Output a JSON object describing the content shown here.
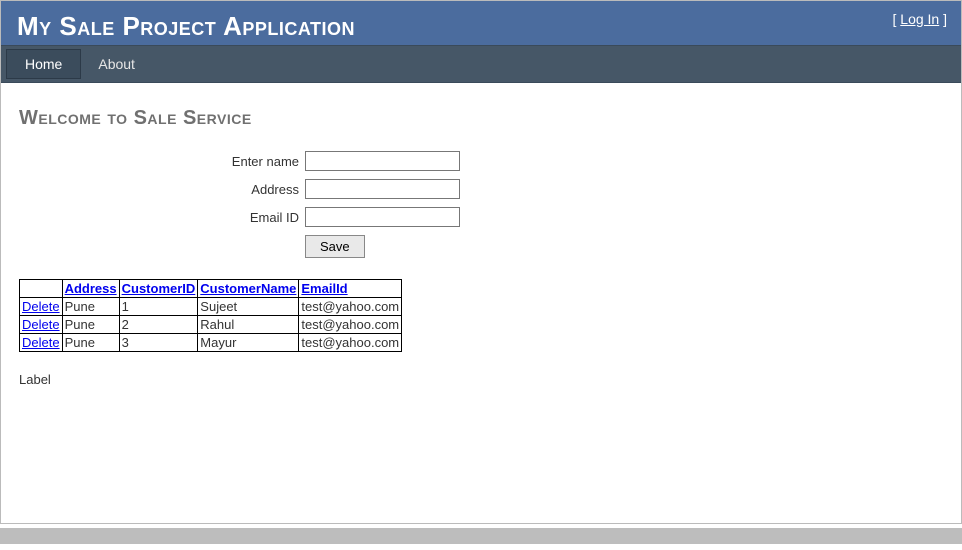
{
  "header": {
    "title": "My Sale Project Application",
    "loginLabel": "Log In"
  },
  "nav": {
    "items": [
      {
        "label": "Home",
        "active": true
      },
      {
        "label": "About",
        "active": false
      }
    ]
  },
  "page": {
    "title": "Welcome to Sale Service"
  },
  "form": {
    "nameLabel": "Enter name",
    "nameValue": "",
    "addressLabel": "Address",
    "addressValue": "",
    "emailLabel": "Email ID",
    "emailValue": "",
    "saveLabel": "Save"
  },
  "table": {
    "deleteLabel": "Delete",
    "headers": {
      "address": "Address",
      "customerId": "CustomerID",
      "customerName": "CustomerName",
      "emailId": "EmailId"
    },
    "rows": [
      {
        "address": "Pune",
        "customerId": "1",
        "customerName": "Sujeet",
        "emailId": "test@yahoo.com"
      },
      {
        "address": "Pune",
        "customerId": "2",
        "customerName": "Rahul",
        "emailId": "test@yahoo.com"
      },
      {
        "address": "Pune",
        "customerId": "3",
        "customerName": "Mayur",
        "emailId": "test@yahoo.com"
      }
    ]
  },
  "placeholder": {
    "labelText": "Label"
  }
}
